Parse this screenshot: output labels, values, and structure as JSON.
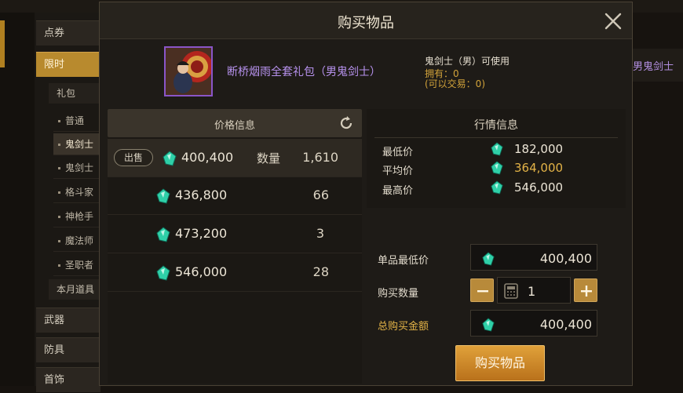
{
  "side_menu": {
    "categories": [
      "点券",
      "限时",
      "武器",
      "防具",
      "首饰"
    ],
    "sub_category": "礼包",
    "items": [
      "普通",
      "鬼剑士",
      "鬼剑士",
      "格斗家",
      "神枪手",
      "魔法师",
      "圣职者"
    ],
    "monthly": "本月道具"
  },
  "background": {
    "right_text": "男鬼剑士"
  },
  "dialog": {
    "title": "购买物品",
    "item": {
      "name": "断桥烟雨全套礼包（男鬼剑士）",
      "usable_by": "鬼剑士（男）可使用",
      "owned": "拥有：0",
      "tradable": "(可以交易：0)"
    },
    "price_panel": {
      "title": "价格信息",
      "sell_label": "出售",
      "qty_label": "数量",
      "rows": [
        {
          "price": "400,400",
          "qty": "1,610"
        },
        {
          "price": "436,800",
          "qty": "66"
        },
        {
          "price": "473,200",
          "qty": "3"
        },
        {
          "price": "546,000",
          "qty": "28"
        }
      ]
    },
    "market": {
      "title": "行情信息",
      "min_label": "最低价",
      "min_value": "182,000",
      "avg_label": "平均价",
      "avg_value": "364,000",
      "max_label": "最高价",
      "max_value": "546,000"
    },
    "form": {
      "unit_price_label": "单品最低价",
      "unit_price_value": "400,400",
      "quantity_label": "购买数量",
      "quantity_value": "1",
      "total_label": "总购买金额",
      "total_value": "400,400"
    },
    "buy_button": "购买物品"
  },
  "colors": {
    "accent_gold": "#e3b347",
    "item_purple": "#b792ee",
    "gem_teal": "#2fd0a8"
  }
}
